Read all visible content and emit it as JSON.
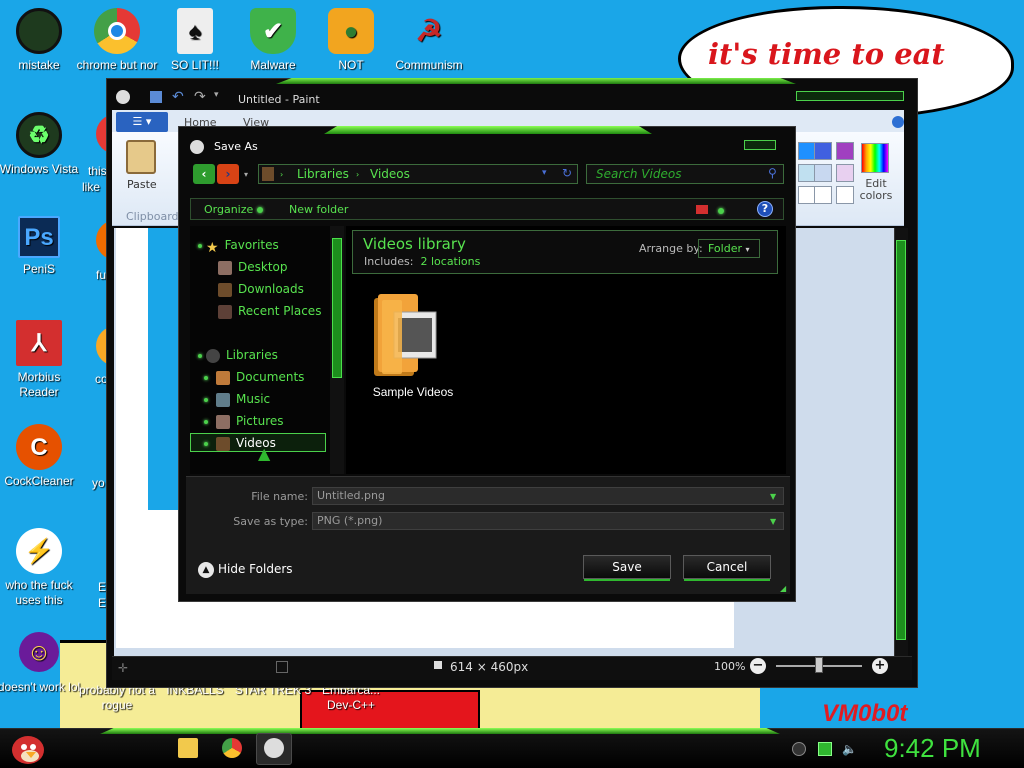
{
  "wallpaper": {
    "speech_bubble": "it's time to eat shit ew",
    "watermark": "VM0b0t"
  },
  "desktop_icons": [
    {
      "label": "mistake",
      "icon": "green-orb-icon",
      "color": "#1e3a1e"
    },
    {
      "label": "chrome but nor",
      "icon": "chrome-icon",
      "color": "#e53935"
    },
    {
      "label": "SO LIT!!!",
      "icon": "playing-cards-icon",
      "color": "#eeeeee"
    },
    {
      "label": "Malware",
      "icon": "shield-check-icon",
      "color": "#3fb24a"
    },
    {
      "label": "NOT",
      "icon": "bad-piggies-icon",
      "color": "#f2a51f"
    },
    {
      "label": "Communism",
      "icon": "red-emblem-icon",
      "color": "#c62828"
    },
    {
      "label": "Windows Vista",
      "icon": "recycle-bin-icon",
      "color": "#1e3a1e"
    },
    {
      "label": "PeniS",
      "icon": "photoshop-icon",
      "color": "#0b2b55"
    },
    {
      "label": "Morbius Reader",
      "icon": "adobe-reader-icon",
      "color": "#d32f2f"
    },
    {
      "label": "CockCleaner",
      "icon": "ccleaner-icon",
      "color": "#e65100"
    },
    {
      "label": "who the fuck uses this",
      "icon": "winamp-bolt-icon",
      "color": "#ffffff"
    },
    {
      "label": "doesn't work lol",
      "icon": "yahoo-messenger-icon",
      "color": "#6a1b9a"
    },
    {
      "label": "probably not a rogue",
      "icon": "installer-icon",
      "color": "#3949ab"
    },
    {
      "label": "INKBALLS",
      "icon": "inkball-icon",
      "color": "#1aa6e8"
    },
    {
      "label": "STAR TREK 3",
      "icon": "star-trek-icon",
      "color": "#1aa6e8"
    },
    {
      "label": "Embarca... Dev-C++",
      "icon": "devcpp-icon",
      "color": "#1aa6e8"
    }
  ],
  "partial_labels": {
    "this": "this",
    "like": "like",
    "fu": "fu",
    "co": "co",
    "yo": "yo",
    "e1": "E",
    "e2": "E"
  },
  "paint": {
    "title": "Untitled - Paint",
    "tabs": [
      "Home",
      "View"
    ],
    "paste_label": "Paste",
    "clipboard_label": "Clipboard",
    "edit_colors_label": "Edit colors",
    "palette": [
      "#1e90ff",
      "#4060e0",
      "#a040c0",
      "#c0e0f0",
      "#c8d8f0",
      "#e8d0f0",
      "#ffffff",
      "#ffffff",
      "#ffffff"
    ],
    "status_size": "614 × 460px",
    "zoom": "100%"
  },
  "save_as": {
    "title": "Save As",
    "breadcrumb": [
      "Libraries",
      "Videos"
    ],
    "search_placeholder": "Search Videos",
    "toolbar": {
      "organize": "Organize",
      "new_folder": "New folder"
    },
    "nav": {
      "favorites": "Favorites",
      "desktop": "Desktop",
      "downloads": "Downloads",
      "recent_places": "Recent Places",
      "libraries": "Libraries",
      "documents": "Documents",
      "music": "Music",
      "pictures": "Pictures",
      "videos": "Videos"
    },
    "library_title": "Videos library",
    "includes_label": "Includes:",
    "includes_value": "2 locations",
    "arrange_label": "Arrange by:",
    "arrange_value": "Folder",
    "folder_item": "Sample Videos",
    "file_name_label": "File name:",
    "file_name_value": "Untitled.png",
    "save_type_label": "Save as type:",
    "save_type_value": "PNG (*.png)",
    "hide_folders": "Hide Folders",
    "save_button": "Save",
    "cancel_button": "Cancel"
  },
  "taskbar": {
    "clock": "9:42 PM"
  },
  "colors": {
    "accent_green": "#58e34f",
    "desktop_blue": "#1aa6e8"
  }
}
